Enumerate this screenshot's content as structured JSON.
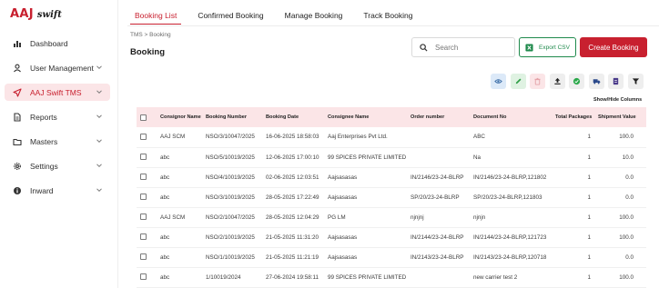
{
  "brand": {
    "name": "AAJ",
    "sub": "swift"
  },
  "sidebar": {
    "items": [
      {
        "label": "Dashboard",
        "icon": "bar-chart-icon",
        "chevron": false,
        "active": false
      },
      {
        "label": "User Management",
        "icon": "user-icon",
        "chevron": true,
        "active": false
      },
      {
        "label": "AAJ Swift TMS",
        "icon": "send-icon",
        "chevron": true,
        "active": true
      },
      {
        "label": "Reports",
        "icon": "document-icon",
        "chevron": true,
        "active": false
      },
      {
        "label": "Masters",
        "icon": "folder-icon",
        "chevron": true,
        "active": false
      },
      {
        "label": "Settings",
        "icon": "gear-icon",
        "chevron": true,
        "active": false
      },
      {
        "label": "Inward",
        "icon": "info-icon",
        "chevron": true,
        "active": false
      }
    ]
  },
  "tabs": [
    {
      "label": "Booking List",
      "active": true
    },
    {
      "label": "Confirmed Booking",
      "active": false
    },
    {
      "label": "Manage Booking",
      "active": false
    },
    {
      "label": "Track Booking",
      "active": false
    }
  ],
  "breadcrumb": "TMS > Booking",
  "page_title": "Booking",
  "search": {
    "placeholder": "Search"
  },
  "actions": {
    "export_label": "Export CSV",
    "create_label": "Create Booking"
  },
  "show_hide_label": "Show/Hide Columns",
  "toolbar": [
    {
      "icon": "eye-icon",
      "bg": "#dce9f8",
      "color": "#3d6fa8"
    },
    {
      "icon": "pencil-icon",
      "bg": "#dff2e2",
      "color": "#2e9e46"
    },
    {
      "icon": "trash-icon",
      "bg": "#fbe5e7",
      "color": "#e4a2a8"
    },
    {
      "icon": "upload-icon",
      "bg": "#eeeeee",
      "color": "#222222"
    },
    {
      "icon": "check-circle-icon",
      "bg": "#eeeeee",
      "color": "#2aa84a"
    },
    {
      "icon": "truck-icon",
      "bg": "#eeeeee",
      "color": "#2b4a8b"
    },
    {
      "icon": "file-icon",
      "bg": "#eeeeee",
      "color": "#4a3a8a"
    },
    {
      "icon": "filter-icon",
      "bg": "#eeeeee",
      "color": "#222222"
    }
  ],
  "colors": {
    "accent": "#c8202f",
    "accent_light": "#fbe5e7",
    "export": "#1f8a4c"
  },
  "table": {
    "columns": [
      "Consignor Name",
      "Booking Number",
      "Booking Date",
      "Consignee Name",
      "Order number",
      "Document No",
      "Total Packages",
      "Shipment Value"
    ],
    "rows": [
      [
        "AAJ SCM",
        "NSO/3/10047/2025",
        "16-06-2025 18:58:03",
        "Aaj Enterprises Pvt Ltd.",
        "",
        "ABC",
        "1",
        "100.0"
      ],
      [
        "abc",
        "NSO/5/10019/2025",
        "12-06-2025 17:00:10",
        "99 SPICES PRIVATE LIMITED",
        "",
        "Na",
        "1",
        "10.0"
      ],
      [
        "abc",
        "NSO/4/10019/2025",
        "02-06-2025 12:03:51",
        "Aajsasasas",
        "IN/2146/23-24-BLRP",
        "IN/2146/23-24-BLRP,121802",
        "1",
        "0.0"
      ],
      [
        "abc",
        "NSO/3/10019/2025",
        "28-05-2025 17:22:49",
        "Aajsasasas",
        "SP/20/23-24-BLRP",
        "SP/20/23-24-BLRP,121803",
        "1",
        "0.0"
      ],
      [
        "AAJ SCM",
        "NSO/2/10047/2025",
        "28-05-2025 12:04:29",
        "PG LM",
        "njnjnj",
        "njnjn",
        "1",
        "100.0"
      ],
      [
        "abc",
        "NSO/2/10019/2025",
        "21-05-2025 11:31:20",
        "Aajsasasas",
        "IN/2144/23-24-BLRP",
        "IN/2144/23-24-BLRP,121723",
        "1",
        "100.0"
      ],
      [
        "abc",
        "NSO/1/10019/2025",
        "21-05-2025 11:21:19",
        "Aajsasasas",
        "IN/2143/23-24-BLRP",
        "IN/2143/23-24-BLRP,120718",
        "1",
        "0.0"
      ],
      [
        "abc",
        "1/10019/2024",
        "27-06-2024 19:58:11",
        "99 SPICES PRIVATE LIMITED",
        "",
        "new carrier test 2",
        "1",
        "100.0"
      ]
    ]
  }
}
